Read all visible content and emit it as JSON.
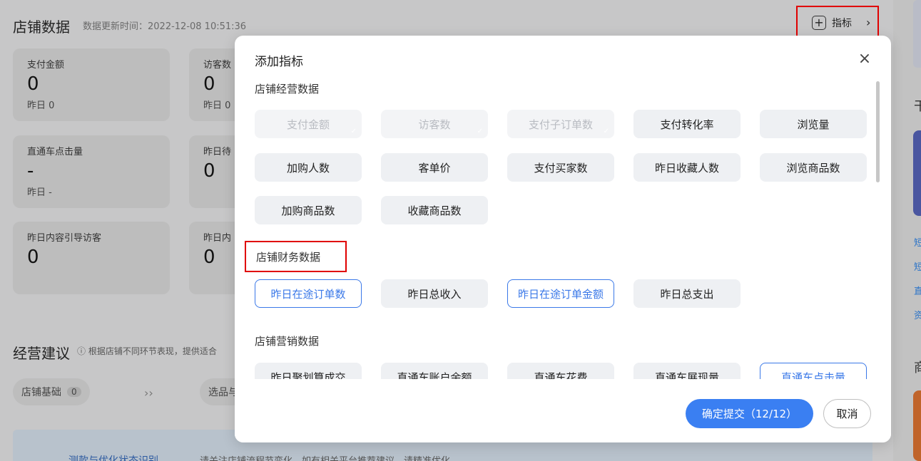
{
  "background": {
    "title": "店铺数据",
    "updated": "数据更新时间：2022-12-08 10:51:36",
    "indicator_button": {
      "label": "指标",
      "icon": "plus-square-icon",
      "chevron": "›"
    },
    "metric_cards": [
      {
        "label": "支付金额",
        "value": "0",
        "sub": "昨日 0"
      },
      {
        "label": "访客数",
        "value": "0",
        "sub": "昨日 0"
      },
      {
        "label": "直通车点击量",
        "value": "-",
        "sub": "昨日 -"
      },
      {
        "label": "昨日待",
        "value": "0",
        "sub": ""
      },
      {
        "label": "昨日内容引导访客",
        "value": "0",
        "sub": ""
      },
      {
        "label": "昨日内",
        "value": "0",
        "sub": ""
      }
    ],
    "section2_title": "经营建议",
    "section2_note": "ⓘ 根据店铺不同环节表现，提供适合",
    "pills": [
      {
        "label": "店铺基础",
        "count": "0"
      },
      {
        "label": "选品与",
        "count": ""
      }
    ],
    "arrows": "››",
    "banner_link": "测款与优化状态识别",
    "banner_text": "请关注店铺流程节变化，如有相关平台推荐建议，请精准优化",
    "right_chars": [
      "干",
      "短",
      "短",
      "直",
      "资",
      "商"
    ]
  },
  "modal": {
    "title": "添加指标",
    "close_icon": "×",
    "groups": [
      {
        "title": "店铺经营数据",
        "items": [
          {
            "label": "支付金额",
            "state": "disabled"
          },
          {
            "label": "访客数",
            "state": "disabled"
          },
          {
            "label": "支付子订单数",
            "state": "disabled"
          },
          {
            "label": "支付转化率",
            "state": "normal"
          },
          {
            "label": "浏览量",
            "state": "normal"
          },
          {
            "label": "加购人数",
            "state": "normal"
          },
          {
            "label": "客单价",
            "state": "normal"
          },
          {
            "label": "支付买家数",
            "state": "normal"
          },
          {
            "label": "昨日收藏人数",
            "state": "normal"
          },
          {
            "label": "浏览商品数",
            "state": "normal"
          },
          {
            "label": "加购商品数",
            "state": "normal"
          },
          {
            "label": "收藏商品数",
            "state": "normal"
          }
        ]
      },
      {
        "title": "店铺财务数据",
        "items": [
          {
            "label": "昨日在途订单数",
            "state": "selected"
          },
          {
            "label": "昨日总收入",
            "state": "normal"
          },
          {
            "label": "昨日在途订单金额",
            "state": "selected"
          },
          {
            "label": "昨日总支出",
            "state": "normal"
          }
        ]
      },
      {
        "title": "店铺营销数据",
        "items": [
          {
            "label": "昨日聚划算成交",
            "state": "normal"
          },
          {
            "label": "直通车账户余额",
            "state": "normal"
          },
          {
            "label": "直通车花费",
            "state": "normal"
          },
          {
            "label": "直通车展现量",
            "state": "normal"
          },
          {
            "label": "直通车点击量",
            "state": "selected"
          }
        ]
      }
    ],
    "confirm_label": "确定提交（12/12）",
    "cancel_label": "取消"
  },
  "colors": {
    "accent": "#3a7ff2",
    "highlight_box": "#e00000",
    "chip_bg": "#eef0f3",
    "overlay": "#c7c7c8"
  }
}
